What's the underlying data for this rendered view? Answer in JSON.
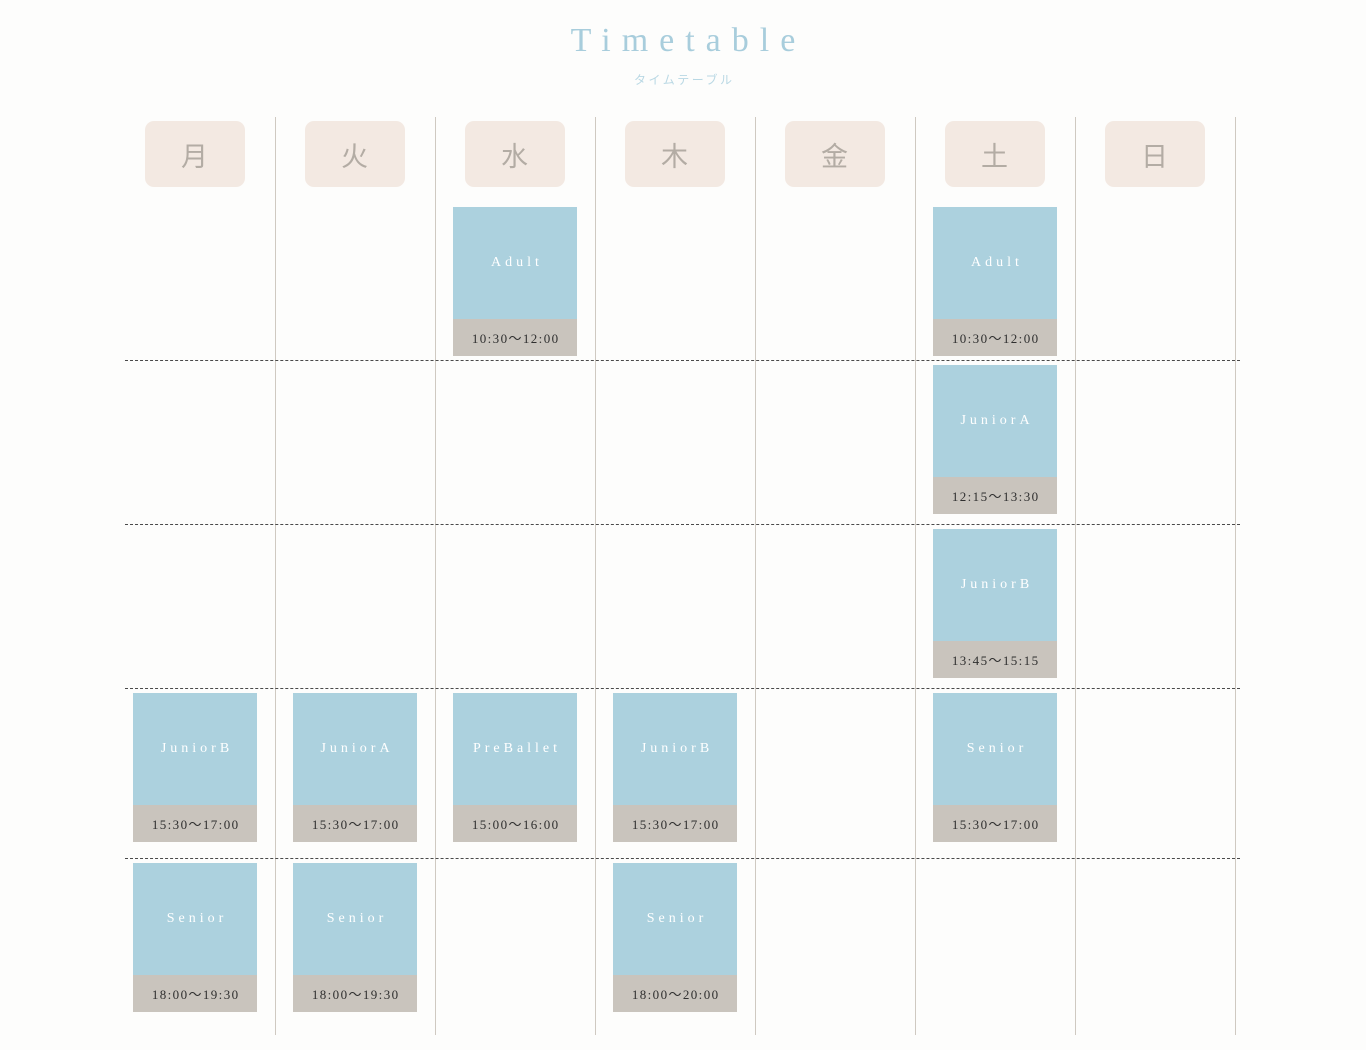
{
  "header": {
    "title": "Timetable",
    "subtitle": "タイムテーブル",
    "title_color": "#a8cddc",
    "subtitle_color": "#b9d8e4"
  },
  "theme": {
    "background": "#fdfdfc",
    "day_chip_bg": "#f3e9e2",
    "day_chip_text": "#b3aca4",
    "card_bg": "#acd1de",
    "card_text": "#ffffff",
    "card_time_bg": "#c9c4bd",
    "card_time_text": "#2f2f2f",
    "column_line": "#cfc9c1",
    "row_line": "#4a4a4a"
  },
  "days": [
    {
      "label": "月",
      "name": "monday"
    },
    {
      "label": "火",
      "name": "tuesday"
    },
    {
      "label": "水",
      "name": "wednesday"
    },
    {
      "label": "木",
      "name": "thursday"
    },
    {
      "label": "金",
      "name": "friday"
    },
    {
      "label": "土",
      "name": "saturday"
    },
    {
      "label": "日",
      "name": "sunday"
    }
  ],
  "classes": [
    {
      "day": "水",
      "day_index": 2,
      "row": 0,
      "name": "Adult",
      "time": "10:30〜12:00"
    },
    {
      "day": "土",
      "day_index": 5,
      "row": 0,
      "name": "Adult",
      "time": "10:30〜12:00"
    },
    {
      "day": "土",
      "day_index": 5,
      "row": 1,
      "name": "JuniorA",
      "time": "12:15〜13:30"
    },
    {
      "day": "土",
      "day_index": 5,
      "row": 2,
      "name": "JuniorB",
      "time": "13:45〜15:15"
    },
    {
      "day": "月",
      "day_index": 0,
      "row": 3,
      "name": "JuniorB",
      "time": "15:30〜17:00"
    },
    {
      "day": "火",
      "day_index": 1,
      "row": 3,
      "name": "JuniorA",
      "time": "15:30〜17:00"
    },
    {
      "day": "水",
      "day_index": 2,
      "row": 3,
      "name": "PreBallet",
      "time": "15:00〜16:00"
    },
    {
      "day": "木",
      "day_index": 3,
      "row": 3,
      "name": "JuniorB",
      "time": "15:30〜17:00"
    },
    {
      "day": "土",
      "day_index": 5,
      "row": 3,
      "name": "Senior",
      "time": "15:30〜17:00"
    },
    {
      "day": "月",
      "day_index": 0,
      "row": 4,
      "name": "Senior",
      "time": "18:00〜19:30"
    },
    {
      "day": "火",
      "day_index": 1,
      "row": 4,
      "name": "Senior",
      "time": "18:00〜19:30"
    },
    {
      "day": "木",
      "day_index": 3,
      "row": 4,
      "name": "Senior",
      "time": "18:00〜20:00"
    }
  ]
}
